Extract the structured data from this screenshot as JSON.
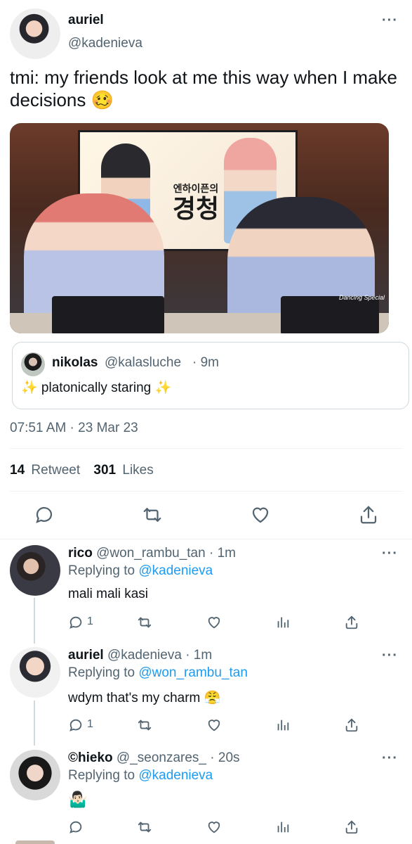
{
  "main_tweet": {
    "author_name": "auriel",
    "author_handle": "@kadenieva",
    "text": "tmi: my friends look at me this way when I make decisions 🥴",
    "media": {
      "screen_title_small": "엔하이픈의",
      "screen_title_big": "경청",
      "watermark": "Dancing Special"
    },
    "quoted": {
      "name": "nikolas",
      "handle": "@kalasluche",
      "time": "· 9m",
      "text": "✨ platonically staring ✨"
    },
    "timestamp": "07:51 AM · 23 Mar 23",
    "retweet_count": "14",
    "retweet_label": "Retweet",
    "like_count": "301",
    "like_label": "Likes"
  },
  "replies": [
    {
      "name": "rico",
      "handle": "@won_rambu_tan",
      "time": "· 1m",
      "replying_prefix": "Replying to",
      "replying_to": "@kadenieva",
      "text": "mali mali kasi",
      "reply_count": "1"
    },
    {
      "name": "auriel",
      "handle": "@kadenieva",
      "time": "· 1m",
      "replying_prefix": "Replying to",
      "replying_to": "@won_rambu_tan",
      "text": "wdym that's my charm 😤",
      "reply_count": "1"
    },
    {
      "name": "©hieko",
      "handle": "@_seonzares_",
      "time": "· 20s",
      "replying_prefix": "Replying to",
      "replying_to": "@kadenieva",
      "text": "🤷🏻‍♂️",
      "reply_count": ""
    }
  ],
  "icons": {
    "more": "…",
    "reply": "reply-icon",
    "retweet": "retweet-icon",
    "like": "heart-icon",
    "share": "share-icon",
    "analytics": "analytics-icon"
  },
  "colors": {
    "text": "#0f1419",
    "secondary": "#536471",
    "link": "#1d9bf0",
    "border": "#cfd9de"
  }
}
